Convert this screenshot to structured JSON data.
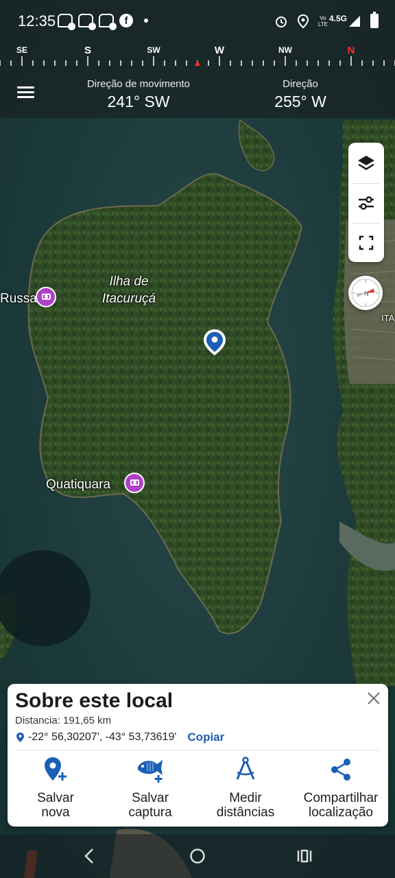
{
  "status_bar": {
    "time": "12:35",
    "network": "4.5G",
    "lte_top": "Vo",
    "lte_bottom": "LTE"
  },
  "compass_strip": {
    "labels": [
      "SE",
      "S",
      "SW",
      "W",
      "NW",
      "N"
    ]
  },
  "header": {
    "movement_caption": "Direção de movimento",
    "movement_value": "241° SW",
    "heading_caption": "Direção",
    "heading_value": "255° W"
  },
  "map": {
    "island_name_line1": "Ilha de",
    "island_name_line2": "Itacuruçá",
    "poi_russa": "Russa",
    "poi_quatiquara": "Quatiquara",
    "edge_label": "ITA"
  },
  "card": {
    "title": "Sobre este local",
    "distance": "Distancia: 191,65 km",
    "coordinates": "-22° 56,30207', -43° 53,73619'",
    "copy_label": "Copiar",
    "actions": [
      {
        "line1": "Salvar",
        "line2": "nova",
        "icon": "add-location-icon"
      },
      {
        "line1": "Salvar",
        "line2": "captura",
        "icon": "fish-add-icon"
      },
      {
        "line1": "Medir",
        "line2": "distâncias",
        "icon": "compass-divider-icon"
      },
      {
        "line1": "Compartilhar",
        "line2": "localização",
        "icon": "share-icon"
      }
    ]
  },
  "colors": {
    "accent_blue": "#1a5fb4",
    "poi_purple": "#b040c8",
    "north_red": "#ff2a2a"
  }
}
